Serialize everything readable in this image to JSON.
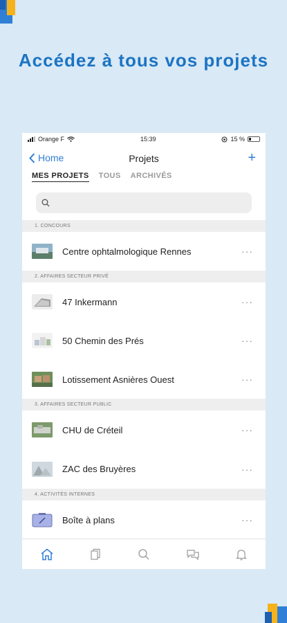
{
  "headline": "Accédez à tous vos projets",
  "status_bar": {
    "carrier": "Orange F",
    "time": "15:39",
    "battery": "15 %"
  },
  "nav": {
    "back_label": "Home",
    "title": "Projets",
    "add_label": "+"
  },
  "tabs": [
    "MES PROJETS",
    "TOUS",
    "ARCHIVÉS"
  ],
  "search": {
    "placeholder": ""
  },
  "sections": [
    {
      "title": "1. CONCOURS",
      "items": [
        "Centre ophtalmologique Rennes"
      ]
    },
    {
      "title": "2. AFFAIRES SECTEUR PRIVÉ",
      "items": [
        "47 Inkermann",
        "50 Chemin des Prés",
        "Lotissement Asnières Ouest"
      ]
    },
    {
      "title": "3. AFFAIRES SECTEUR PUBLIC",
      "items": [
        "CHU de Créteil",
        "ZAC des Bruyères"
      ]
    },
    {
      "title": "4. ACTIVITÉS INTERNES",
      "items": [
        "Boîte à plans"
      ]
    }
  ],
  "more_label": "···",
  "colors": {
    "accent": "#2f7fd6",
    "headline": "#1c74c4",
    "background": "#d9e9f5"
  },
  "tabbar_icons": [
    "home-icon",
    "documents-icon",
    "search-icon",
    "chat-icon",
    "bell-icon"
  ]
}
